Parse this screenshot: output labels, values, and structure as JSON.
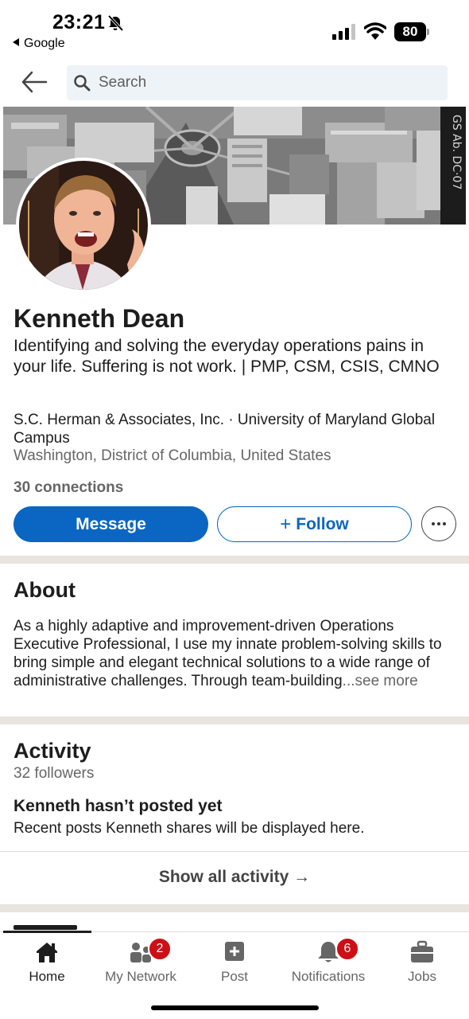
{
  "status_bar": {
    "time": "23:21",
    "back_app": "Google",
    "battery": "80"
  },
  "search": {
    "placeholder": "Search"
  },
  "profile": {
    "name": "Kenneth Dean",
    "headline": "Identifying and solving the everyday operations pains in your life. Suffering is not work. | PMP, CSM, CSIS, CMNO",
    "company": "S.C. Herman & Associates, Inc. · University of Maryland Global Campus",
    "location": "Washington, District of Columbia, United States",
    "connections": "30 connections",
    "message_label": "Message",
    "follow_label": "Follow"
  },
  "about": {
    "title": "About",
    "text": "As a highly adaptive and improvement-driven Operations Executive Professional, I use my innate problem-solving skills to bring simple and elegant technical solutions to a wide range of administrative challenges. Through team-building",
    "see_more": "...see more"
  },
  "activity": {
    "title": "Activity",
    "followers": "32 followers",
    "no_post_title": "Kenneth hasn’t posted yet",
    "no_post_desc": "Recent posts Kenneth shares will be displayed here.",
    "show_all": "Show all activity →"
  },
  "tabs": [
    {
      "label": "Home",
      "icon": "home-icon",
      "active": true
    },
    {
      "label": "My Network",
      "icon": "people-icon",
      "badge": "2"
    },
    {
      "label": "Post",
      "icon": "plus-square-icon"
    },
    {
      "label": "Notifications",
      "icon": "bell-icon",
      "badge": "6"
    },
    {
      "label": "Jobs",
      "icon": "briefcase-icon"
    }
  ],
  "colors": {
    "primary": "#0a66c2",
    "badge": "#cc1016",
    "divider": "#e8e4de"
  }
}
